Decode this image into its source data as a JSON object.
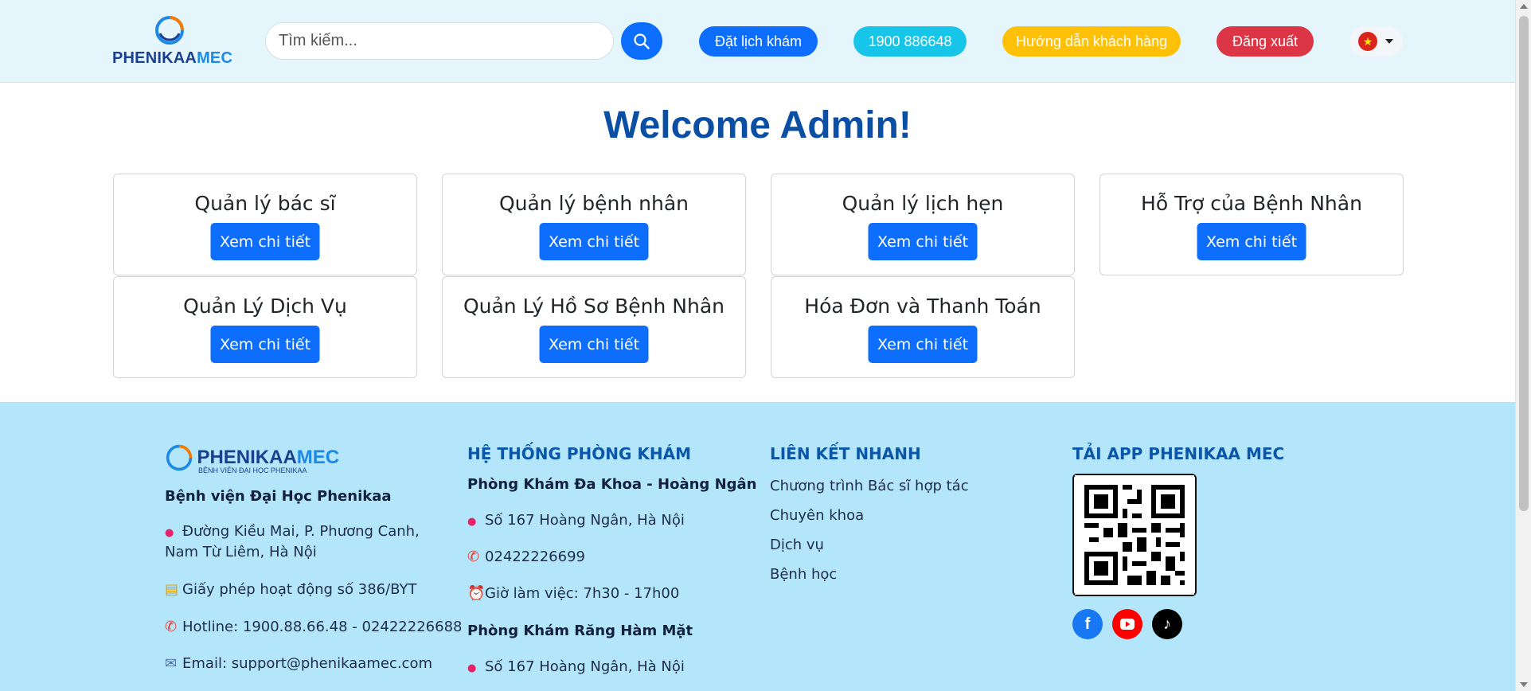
{
  "header": {
    "logo": {
      "brand_part1": "PHENIKAA",
      "brand_part2": "MEC"
    },
    "search": {
      "placeholder": "Tìm kiếm..."
    },
    "buttons": {
      "book": "Đặt lịch khám",
      "phone": "1900 886648",
      "guide": "Hướng dẫn khách hàng",
      "logout": "Đăng xuất"
    },
    "language": {
      "flag": "vn-flag-icon"
    }
  },
  "main": {
    "welcome": "Welcome Admin!",
    "cards": [
      {
        "title": "Quản lý bác sĩ",
        "button": "Xem chi tiết"
      },
      {
        "title": "Quản lý bệnh nhân",
        "button": "Xem chi tiết"
      },
      {
        "title": "Quản lý lịch hẹn",
        "button": "Xem chi tiết"
      },
      {
        "title": "Hỗ Trợ của Bệnh Nhân",
        "button": "Xem chi tiết"
      },
      {
        "title": "Quản Lý Dịch Vụ",
        "button": "Xem chi tiết"
      },
      {
        "title": "Quản Lý Hồ Sơ Bệnh Nhân",
        "button": "Xem chi tiết"
      },
      {
        "title": "Hóa Đơn và Thanh Toán",
        "button": "Xem chi tiết"
      }
    ]
  },
  "footer": {
    "logo": {
      "brand_part1": "PHENIKAA",
      "brand_part2": "MEC",
      "subtitle": "BỆNH VIỆN ĐẠI HỌC PHENIKAA"
    },
    "hospital_name": "Bệnh viện Đại Học Phenikaa",
    "address": "Đường Kiều Mai, P. Phương Canh,",
    "address2": "Nam Từ Liêm, Hà Nội",
    "license": "Giấy phép hoạt động số 386/BYT",
    "hotline": "Hotline: 1900.88.66.48 - 02422226688",
    "email": "Email: support@phenikaamec.com",
    "clinics_heading": "HỆ THỐNG PHÒNG KHÁM",
    "clinic1_name": "Phòng Khám Đa Khoa - Hoàng Ngân",
    "clinic1_address": "Số 167 Hoàng Ngân, Hà Nội",
    "clinic1_phone": "02422226699",
    "clinic1_hours": "Giờ làm việc: 7h30 - 17h00",
    "clinic2_name": "Phòng Khám Răng Hàm Mặt",
    "clinic2_address": "Số 167 Hoàng Ngân, Hà Nội",
    "links_heading": "LIÊN KẾT NHANH",
    "links": [
      "Chương trình Bác sĩ hợp tác",
      "Chuyên khoa",
      "Dịch vụ",
      "Bệnh học"
    ],
    "app_heading": "TẢI APP PHENIKAA MEC",
    "social": {
      "facebook": "facebook-icon",
      "youtube": "youtube-icon",
      "tiktok": "tiktok-icon"
    }
  },
  "colors": {
    "primary": "#0d6efd",
    "info": "#17c5e8",
    "warning": "#ffc107",
    "danger": "#dc3545",
    "welcome": "#0a4fa3",
    "header_bg": "#e4f6fb",
    "footer_bg": "#b3e5fb"
  }
}
